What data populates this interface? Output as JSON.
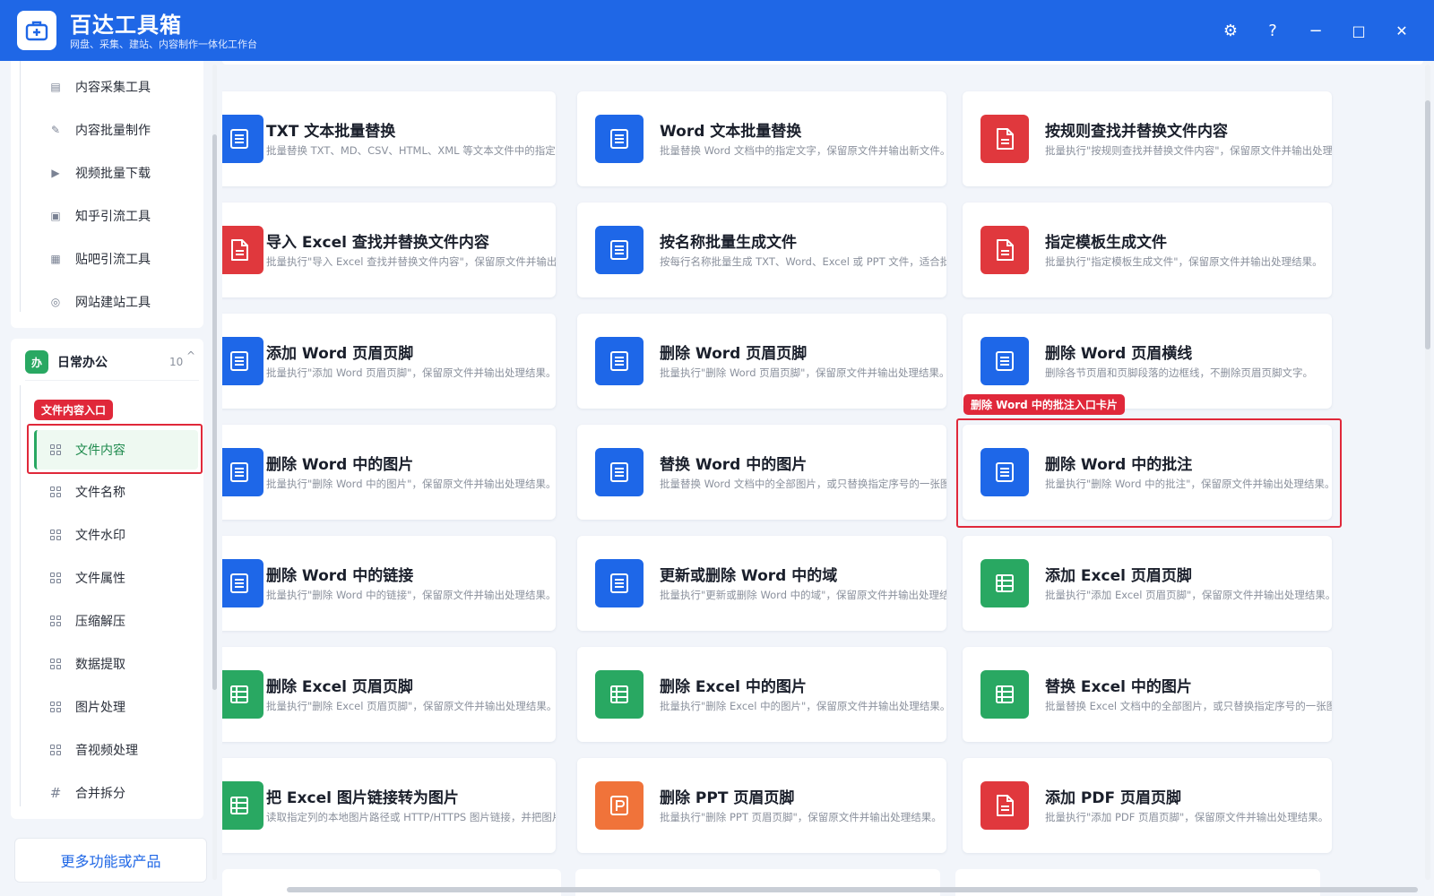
{
  "app": {
    "title": "百达工具箱",
    "subtitle": "网盘、采集、建站、内容制作一体化工作台"
  },
  "window_controls": {
    "settings": "⚙",
    "help": "?",
    "minimize": "−",
    "maximize": "□",
    "close": "✕"
  },
  "sidebar": {
    "top_items": [
      {
        "label": "内容采集工具",
        "icon": "doc-icon"
      },
      {
        "label": "内容批量制作",
        "icon": "pen-icon"
      },
      {
        "label": "视频批量下载",
        "icon": "video-icon"
      },
      {
        "label": "知乎引流工具",
        "icon": "zhihu-icon"
      },
      {
        "label": "贴吧引流工具",
        "icon": "tieba-icon"
      },
      {
        "label": "网站建站工具",
        "icon": "globe-icon"
      }
    ],
    "group": {
      "badge": "办",
      "title": "日常办公",
      "count": "10",
      "chevron": "^"
    },
    "group_items": [
      {
        "label": "文件内容"
      },
      {
        "label": "文件名称"
      },
      {
        "label": "文件水印"
      },
      {
        "label": "文件属性"
      },
      {
        "label": "压缩解压"
      },
      {
        "label": "数据提取"
      },
      {
        "label": "图片处理"
      },
      {
        "label": "音视频处理"
      },
      {
        "label": "合并拆分",
        "icon": "#"
      }
    ],
    "more_link": "更多功能或产品"
  },
  "annotations": {
    "sidebar_label": "文件内容入口",
    "card_label": "删除 Word 中的批注入口卡片"
  },
  "cards": [
    {
      "title": "TXT 文本批量替换",
      "desc": "批量替换 TXT、MD、CSV、HTML、XML 等文本文件中的指定内容",
      "color": "blue",
      "icon": "doc-icon"
    },
    {
      "title": "Word 文本批量替换",
      "desc": "批量替换 Word 文档中的指定文字，保留原文件并输出新文件。",
      "color": "blue",
      "icon": "doc-icon"
    },
    {
      "title": "按规则查找并替换文件内容",
      "desc": "批量执行\"按规则查找并替换文件内容\"，保留原文件并输出处理结果。",
      "color": "red",
      "icon": "file-icon"
    },
    {
      "title": "导入 Excel 查找并替换文件内容",
      "desc": "批量执行\"导入 Excel 查找并替换文件内容\"，保留原文件并输出处理结果。",
      "color": "red",
      "icon": "file-icon"
    },
    {
      "title": "按名称批量生成文件",
      "desc": "按每行名称批量生成 TXT、Word、Excel 或 PPT 文件，适合批量建档。",
      "color": "blue",
      "icon": "doc-icon"
    },
    {
      "title": "指定模板生成文件",
      "desc": "批量执行\"指定模板生成文件\"，保留原文件并输出处理结果。",
      "color": "red",
      "icon": "file-icon"
    },
    {
      "title": "添加 Word 页眉页脚",
      "desc": "批量执行\"添加 Word 页眉页脚\"，保留原文件并输出处理结果。",
      "color": "blue",
      "icon": "doc-icon"
    },
    {
      "title": "删除 Word 页眉页脚",
      "desc": "批量执行\"删除 Word 页眉页脚\"，保留原文件并输出处理结果。",
      "color": "blue",
      "icon": "doc-icon"
    },
    {
      "title": "删除 Word 页眉横线",
      "desc": "删除各节页眉和页脚段落的边框线，不删除页眉页脚文字。",
      "color": "blue",
      "icon": "doc-icon"
    },
    {
      "title": "删除 Word 中的图片",
      "desc": "批量执行\"删除 Word 中的图片\"，保留原文件并输出处理结果。",
      "color": "blue",
      "icon": "doc-icon"
    },
    {
      "title": "替换 Word 中的图片",
      "desc": "批量替换 Word 文档中的全部图片，或只替换指定序号的一张图片。",
      "color": "blue",
      "icon": "doc-icon"
    },
    {
      "title": "删除 Word 中的批注",
      "desc": "批量执行\"删除 Word 中的批注\"，保留原文件并输出处理结果。",
      "color": "blue",
      "icon": "doc-icon"
    },
    {
      "title": "删除 Word 中的链接",
      "desc": "批量执行\"删除 Word 中的链接\"，保留原文件并输出处理结果。",
      "color": "blue",
      "icon": "doc-icon"
    },
    {
      "title": "更新或删除 Word 中的域",
      "desc": "批量执行\"更新或删除 Word 中的域\"，保留原文件并输出处理结果。",
      "color": "blue",
      "icon": "doc-icon"
    },
    {
      "title": "添加 Excel 页眉页脚",
      "desc": "批量执行\"添加 Excel 页眉页脚\"，保留原文件并输出处理结果。",
      "color": "green",
      "icon": "sheet-icon"
    },
    {
      "title": "删除 Excel 页眉页脚",
      "desc": "批量执行\"删除 Excel 页眉页脚\"，保留原文件并输出处理结果。",
      "color": "green",
      "icon": "sheet-icon"
    },
    {
      "title": "删除 Excel 中的图片",
      "desc": "批量执行\"删除 Excel 中的图片\"，保留原文件并输出处理结果。",
      "color": "green",
      "icon": "sheet-icon"
    },
    {
      "title": "替换 Excel 中的图片",
      "desc": "批量替换 Excel 文档中的全部图片，或只替换指定序号的一张图片。",
      "color": "green",
      "icon": "sheet-icon"
    },
    {
      "title": "把 Excel 图片链接转为图片",
      "desc": "读取指定列的本地图片路径或 HTTP/HTTPS 图片链接，并把图片嵌入表格。",
      "color": "green",
      "icon": "sheet-icon"
    },
    {
      "title": "删除 PPT 页眉页脚",
      "desc": "批量执行\"删除 PPT 页眉页脚\"，保留原文件并输出处理结果。",
      "color": "orange",
      "icon": "ppt-icon"
    },
    {
      "title": "添加 PDF 页眉页脚",
      "desc": "批量执行\"添加 PDF 页眉页脚\"，保留原文件并输出处理结果。",
      "color": "red",
      "icon": "file-icon"
    }
  ]
}
